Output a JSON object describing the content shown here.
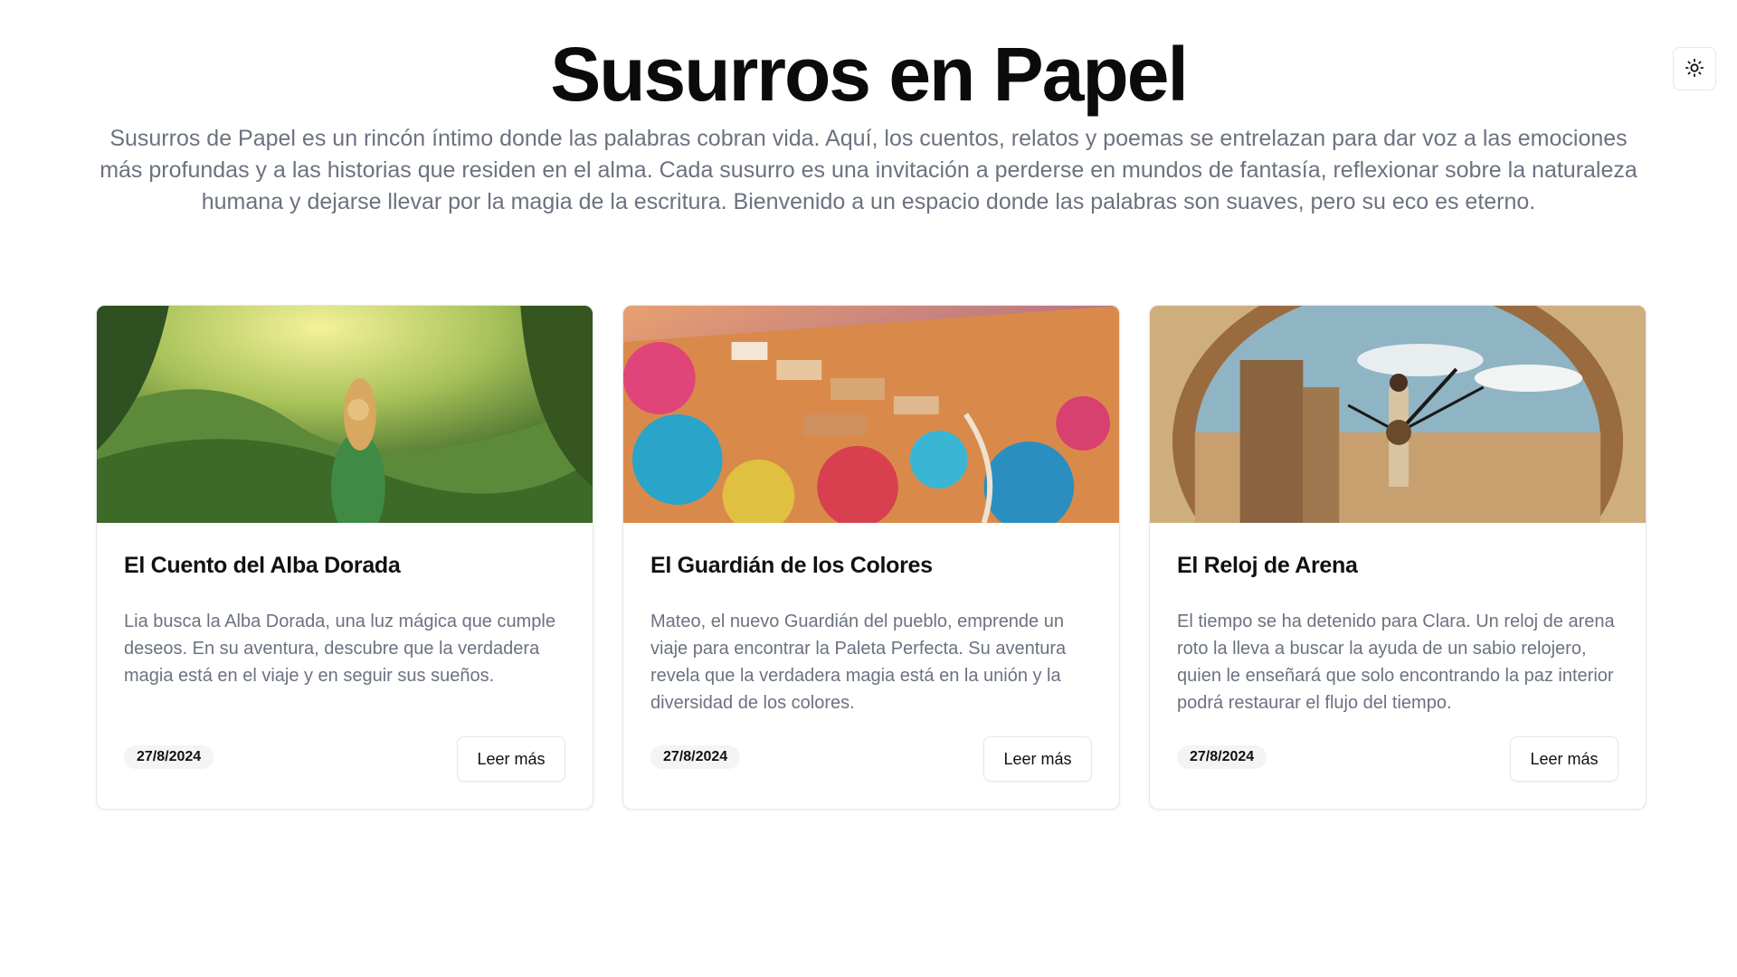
{
  "header": {
    "title": "Susurros en Papel",
    "intro": "Susurros de Papel es un rincón íntimo donde las palabras cobran vida. Aquí, los cuentos, relatos y poemas se entrelazan para dar voz a las emociones más profundas y a las historias que residen en el alma. Cada susurro es una invitación a perderse en mundos de fantasía, reflexionar sobre la naturaleza humana y dejarse llevar por la magia de la escritura. Bienvenido a un espacio donde las palabras son suaves, pero su eco es eterno."
  },
  "theme_toggle": {
    "icon": "sun-icon"
  },
  "cards": [
    {
      "title": "El Cuento del Alba Dorada",
      "description": "Lia busca la Alba Dorada, una luz mágica que cumple deseos. En su aventura, descubre que la verdadera magia está en el viaje y en seguir sus sueños.",
      "date": "27/8/2024",
      "button": "Leer más",
      "image": "girl-in-green-forest-illustration"
    },
    {
      "title": "El Guardián de los Colores",
      "description": "Mateo, el nuevo Guardián del pueblo, emprende un viaje para encontrar la Paleta Perfecta. Su aventura revela que la verdadera magia está en la unión y la diversidad de los colores.",
      "date": "27/8/2024",
      "button": "Leer más",
      "image": "colorful-hillside-village-illustration"
    },
    {
      "title": "El Reloj de Arena",
      "description": "El tiempo se ha detenido para Clara. Un reloj de arena roto la lleva a buscar la ayuda de un sabio relojero, quien le enseñará que solo encontrando la paz interior podrá restaurar el flujo del tiempo.",
      "date": "27/8/2024",
      "button": "Leer más",
      "image": "woman-in-clock-desert-illustration"
    }
  ]
}
